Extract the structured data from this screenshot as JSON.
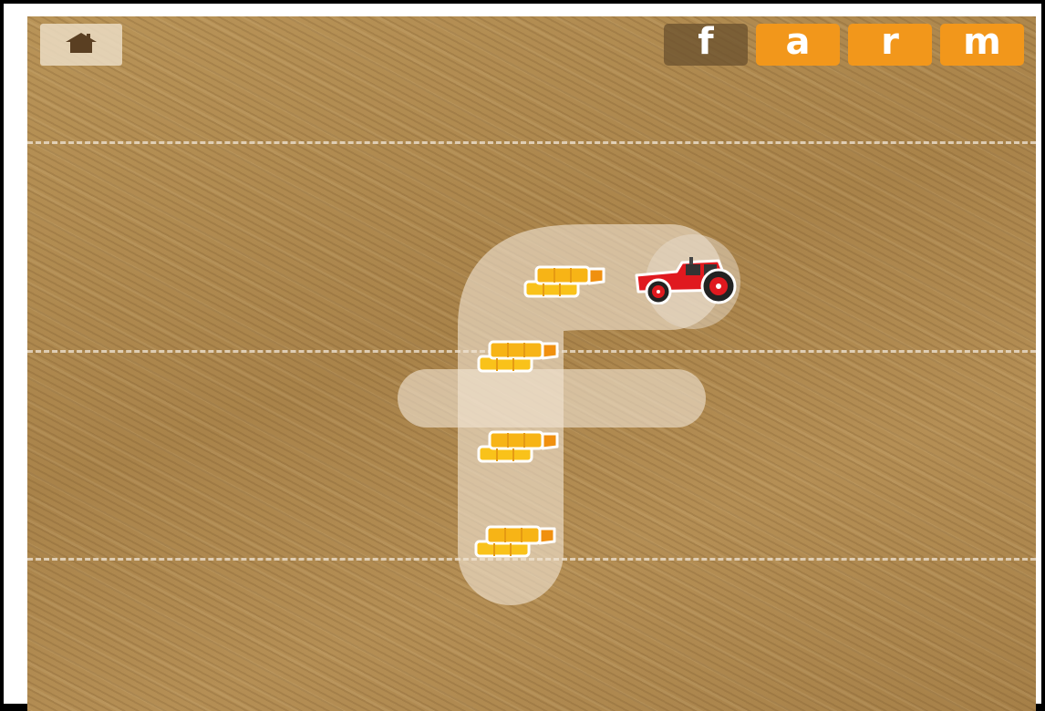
{
  "toolbar": {
    "home_icon": "house-icon"
  },
  "game": {
    "current_letter": "f",
    "word_letters": [
      {
        "label": "f",
        "state": "active"
      },
      {
        "label": "a",
        "state": "pending"
      },
      {
        "label": "r",
        "state": "pending"
      },
      {
        "label": "m",
        "state": "pending"
      }
    ],
    "tracing_items": [
      "hay-bale-icon",
      "hay-bale-icon",
      "hay-bale-icon",
      "hay-bale-icon"
    ],
    "player_icon": "tractor-icon"
  },
  "colors": {
    "tile_pending": "#f2971b",
    "tile_active": "#69502d",
    "trace_path": "#f0e4d2",
    "tractor": "#e0191f",
    "hay": "#f7b416"
  }
}
